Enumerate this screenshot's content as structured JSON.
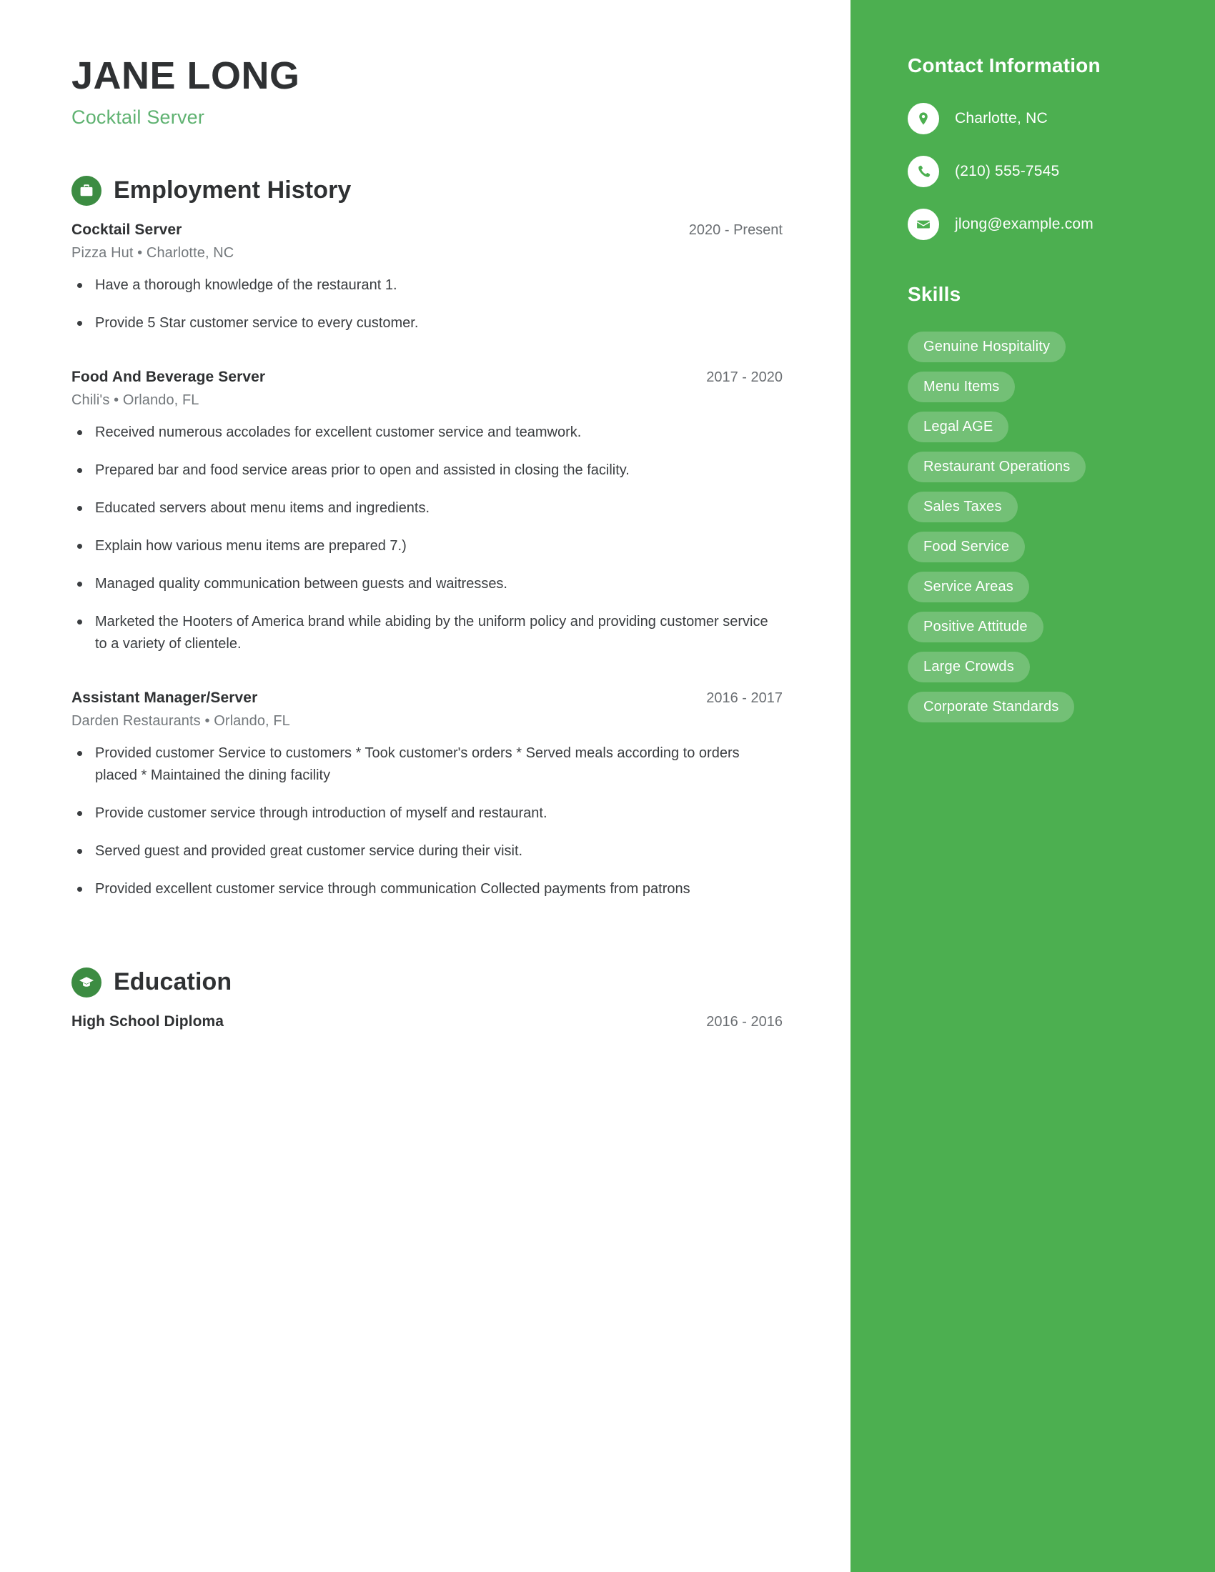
{
  "header": {
    "name": "JANE LONG",
    "title": "Cocktail Server"
  },
  "colors": {
    "sidebar_green": "#4caf50",
    "accent_green": "#5fb271",
    "icon_circle_green": "#3c8c42",
    "heading_dark": "#2f3133"
  },
  "sections": {
    "employment": {
      "title": "Employment History",
      "icon": "briefcase-icon",
      "entries": [
        {
          "role": "Cocktail Server",
          "dates": "2020 - Present",
          "meta": "Pizza Hut  •  Charlotte, NC",
          "bullets": [
            "Have a thorough knowledge of the restaurant 1.",
            "Provide 5 Star customer service to every customer."
          ]
        },
        {
          "role": "Food And Beverage Server",
          "dates": "2017 - 2020",
          "meta": "Chili's  •  Orlando, FL",
          "bullets": [
            "Received numerous accolades for excellent customer service and teamwork.",
            "Prepared bar and food service areas prior to open and assisted in closing the facility.",
            "Educated servers about menu items and ingredients.",
            "Explain how various menu items are prepared 7.)",
            "Managed quality communication between guests and waitresses.",
            "Marketed the Hooters of America brand while abiding by the uniform policy and providing customer service to a variety of clientele."
          ]
        },
        {
          "role": "Assistant Manager/Server",
          "dates": "2016 - 2017",
          "meta": "Darden Restaurants  •  Orlando, FL",
          "bullets": [
            "Provided customer Service to customers * Took customer's orders * Served meals according to orders placed * Maintained the dining facility",
            "Provide customer service through introduction of myself and restaurant.",
            "Served guest and provided great customer service during their visit.",
            "Provided excellent customer service through communication Collected payments from patrons"
          ]
        }
      ]
    },
    "education": {
      "title": "Education",
      "icon": "graduation-cap-icon",
      "entries": [
        {
          "degree": "High School Diploma",
          "dates": "2016 - 2016"
        }
      ]
    }
  },
  "sidebar": {
    "contact": {
      "title": "Contact Information",
      "items": [
        {
          "icon": "location-pin-icon",
          "value": "Charlotte, NC"
        },
        {
          "icon": "phone-icon",
          "value": "(210) 555-7545"
        },
        {
          "icon": "envelope-icon",
          "value": "jlong@example.com"
        }
      ]
    },
    "skills": {
      "title": "Skills",
      "items": [
        "Genuine Hospitality",
        "Menu Items",
        "Legal AGE",
        "Restaurant Operations",
        "Sales Taxes",
        "Food Service",
        "Service Areas",
        "Positive Attitude",
        "Large Crowds",
        "Corporate Standards"
      ]
    }
  }
}
